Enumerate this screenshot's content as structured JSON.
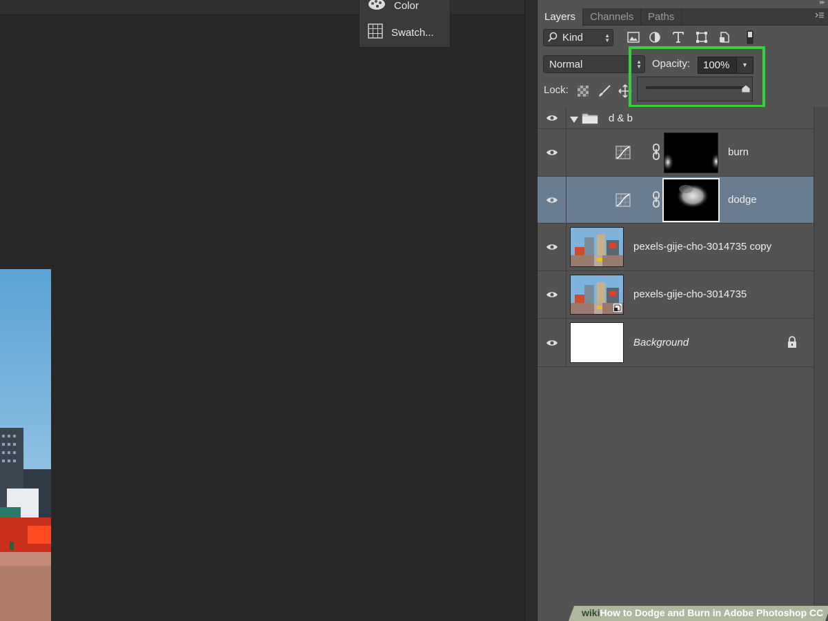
{
  "mini_panels": [
    {
      "label": "Color",
      "icon": "palette-icon"
    },
    {
      "label": "Swatch...",
      "icon": "swatches-icon"
    }
  ],
  "layers_panel": {
    "tabs": [
      {
        "label": "Layers",
        "active": true
      },
      {
        "label": "Channels",
        "active": false
      },
      {
        "label": "Paths",
        "active": false
      }
    ],
    "filter": {
      "kind_label": "Kind",
      "icons": [
        "pixel-filter-icon",
        "adjustment-filter-icon",
        "type-filter-icon",
        "shape-filter-icon",
        "smart-object-filter-icon",
        "filter-toggle-icon"
      ]
    },
    "blend_mode": "Normal",
    "opacity_label": "Opacity:",
    "opacity_value": "100%",
    "opacity_fraction": 1.0,
    "lock_label": "Lock:",
    "lock_icons": [
      "lock-transparent-icon",
      "lock-paint-icon",
      "lock-position-icon"
    ]
  },
  "layers": [
    {
      "name": "d & b",
      "type": "group",
      "expanded": true
    },
    {
      "name": "burn",
      "type": "adjustment",
      "mask": "burn",
      "selected": false
    },
    {
      "name": "dodge",
      "type": "adjustment",
      "mask": "dodge",
      "selected": true
    },
    {
      "name": "pexels-gije-cho-3014735 copy",
      "type": "image"
    },
    {
      "name": "pexels-gije-cho-3014735",
      "type": "smart-image"
    },
    {
      "name": "Background",
      "type": "background",
      "locked": true
    }
  ],
  "footer": {
    "brand": "wiki",
    "title": "How to Dodge and Burn in Adobe Photoshop CC"
  },
  "colors": {
    "highlight": "#36d13a",
    "selected_row": "#6a7c90",
    "panel": "#535353",
    "canvas": "#282828"
  }
}
